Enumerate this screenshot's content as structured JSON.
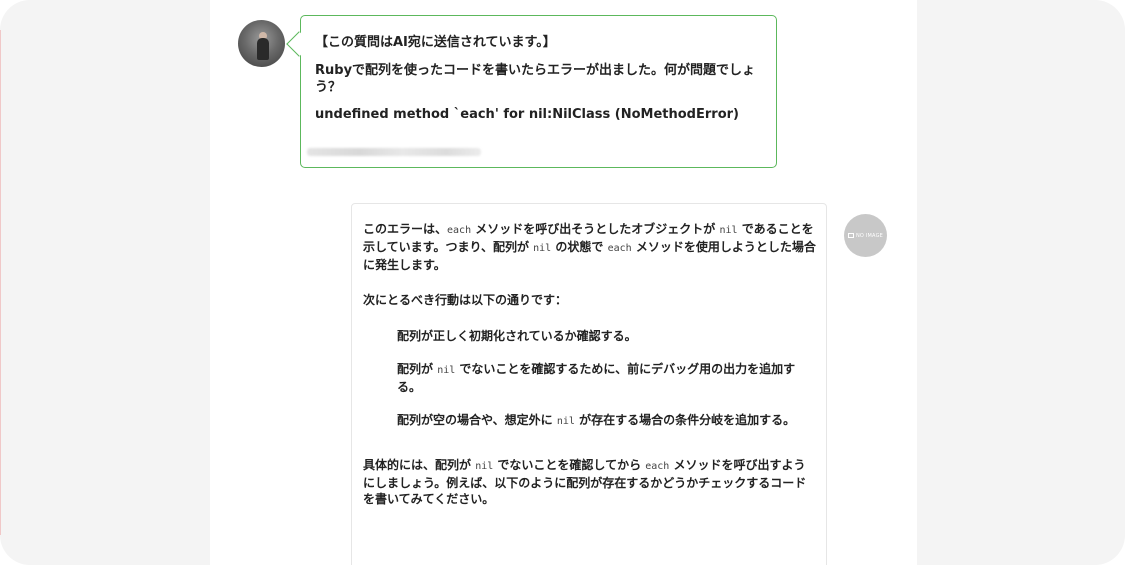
{
  "user_message": {
    "prefix": "【この質問はAI宛に送信されています。】",
    "question": "Rubyで配列を使ったコードを書いたらエラーが出ました。何が問題でしょう？",
    "error": "undefined method `each' for nil:NilClass (NoMethodError)"
  },
  "ai_response": {
    "avatar_text": "NO IMAGE",
    "intro": {
      "t1": "このエラーは、",
      "c1": "each",
      "t2": " メソッドを呼び出そうとしたオブジェクトが ",
      "c2": "nil",
      "t3": " であることを示しています。つまり、配列が ",
      "c3": "nil",
      "t4": " の状態で ",
      "c4": "each",
      "t5": " メソッドを使用しようとした場合に発生します。"
    },
    "next_steps_heading": "次にとるべき行動は以下の通りです：",
    "steps": [
      {
        "t1": "配列が正しく初期化されているか確認する。"
      },
      {
        "t1": "配列が ",
        "c1": "nil",
        "t2": " でないことを確認するために、前にデバッグ用の出力を追加する。"
      },
      {
        "t1": "配列が空の場合や、想定外に ",
        "c1": "nil",
        "t2": " が存在する場合の条件分岐を追加する。"
      }
    ],
    "conclusion": {
      "t1": "具体的には、配列が ",
      "c1": "nil",
      "t2": " でないことを確認してから ",
      "c2": "each",
      "t3": " メソッドを呼び出すようにしましょう。例えば、以下のように配列が存在するかどうかチェックするコードを書いてみてください。"
    }
  },
  "colors": {
    "user_bubble_border": "#5cb85c",
    "ai_avatar_bg": "#c8c8c8",
    "frame_bg": "#f4f4f4"
  }
}
